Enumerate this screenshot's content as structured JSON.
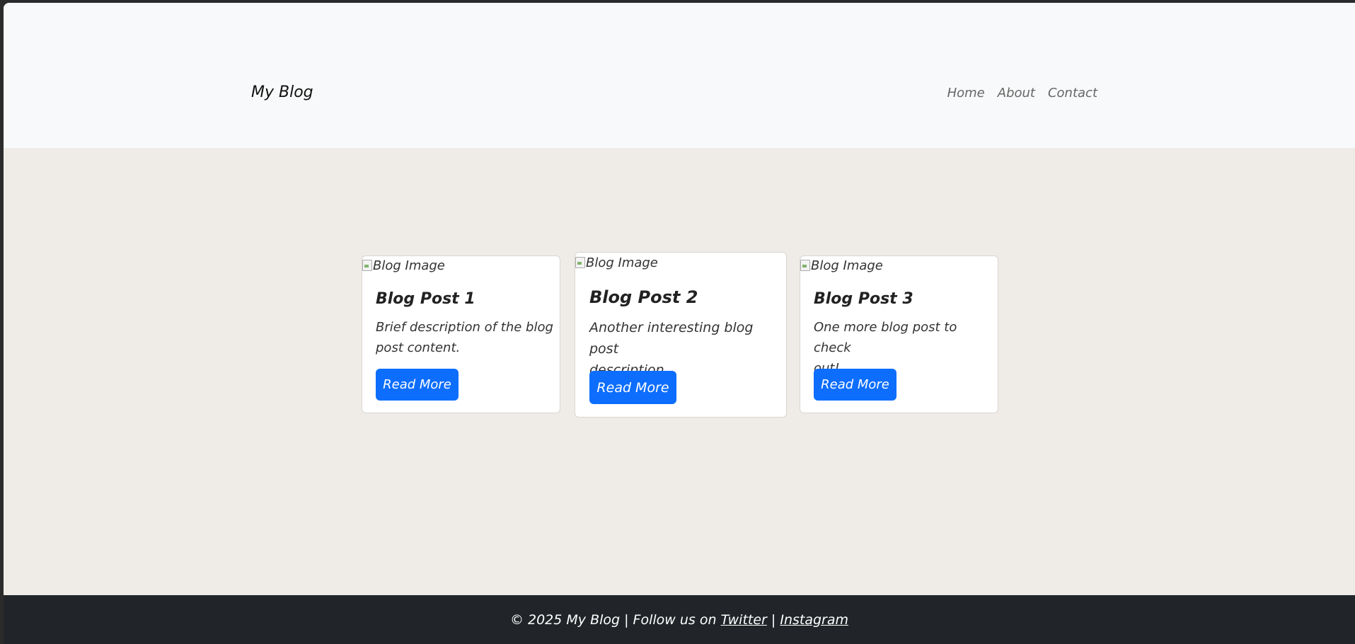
{
  "navbar": {
    "brand": "My Blog",
    "links": [
      "Home",
      "About",
      "Contact"
    ]
  },
  "posts": [
    {
      "image_alt": "Blog Image",
      "title": "Blog Post 1",
      "text_line1": "Brief description of the blog",
      "text_line2": "post content.",
      "button": "Read More"
    },
    {
      "image_alt": "Blog Image",
      "title": "Blog Post 2",
      "text_line1": "Another interesting blog post",
      "text_line2": "description.",
      "button": "Read More"
    },
    {
      "image_alt": "Blog Image",
      "title": "Blog Post 3",
      "text_line1": "One more blog post to check",
      "text_line2": "out!",
      "button": "Read More"
    }
  ],
  "footer": {
    "prefix": "© 2025 My Blog | Follow us on",
    "link1": "Twitter",
    "separator": "|",
    "link2": "Instagram"
  },
  "colors": {
    "primary": "#0d6efd",
    "footer_bg": "#212529",
    "nav_bg": "#f8f9fa",
    "page_bg": "#efebe7"
  }
}
